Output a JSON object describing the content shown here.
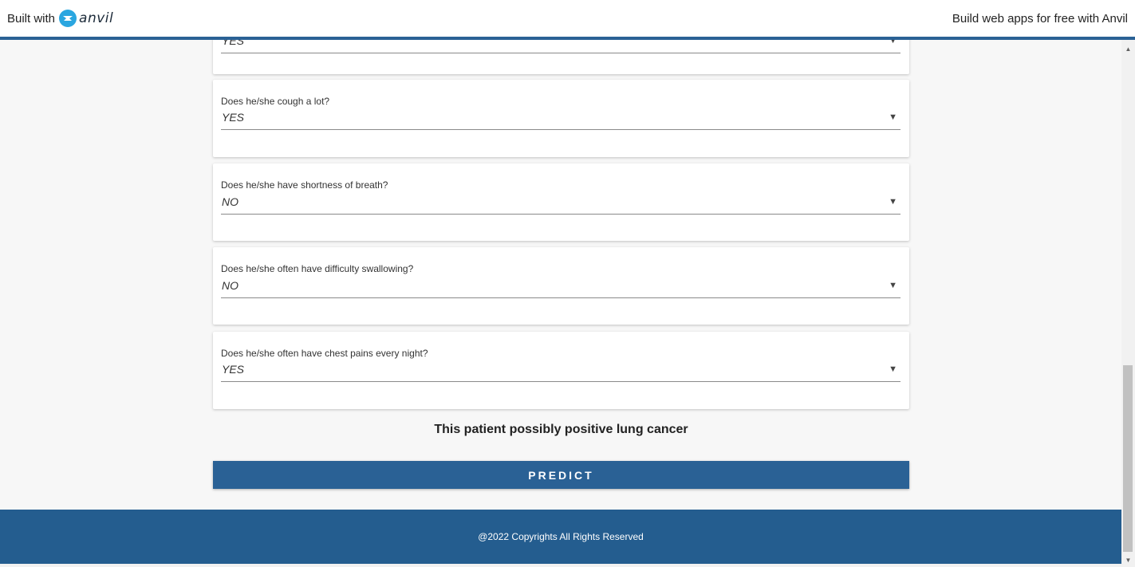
{
  "banner": {
    "built_with": "Built with",
    "logo_text": "anvil",
    "link": "Build web apps for free with Anvil"
  },
  "questions": [
    {
      "label": "",
      "value": "YES"
    },
    {
      "label": "Does he/she cough a lot?",
      "value": "YES"
    },
    {
      "label": "Does he/she have shortness of breath?",
      "value": "NO"
    },
    {
      "label": "Does he/she often have difficulty swallowing?",
      "value": "NO"
    },
    {
      "label": "Does he/she often have chest pains every night?",
      "value": "YES"
    }
  ],
  "result_text": "This patient possibly positive lung cancer",
  "predict_label": "PREDICT",
  "footer_text": "@2022 Copyrights All Rights Reserved",
  "colors": {
    "primary": "#2a6195",
    "footer": "#245d8f",
    "logo": "#2aa6e0"
  },
  "icons": {
    "dropdown": "triangle-down",
    "logo": "anvil-logo"
  }
}
